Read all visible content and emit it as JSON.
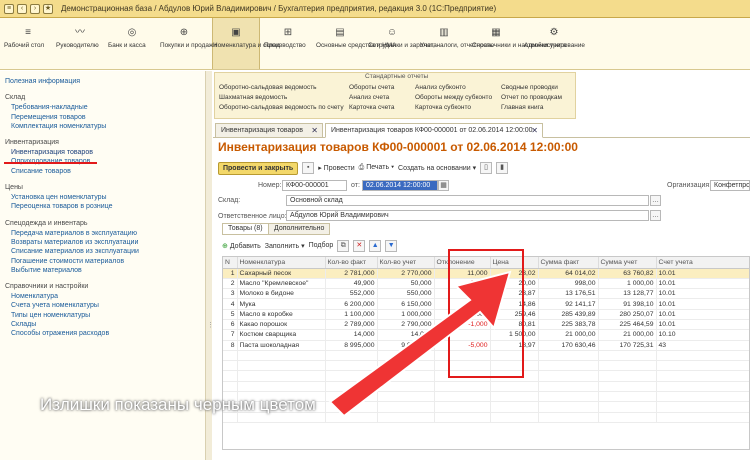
{
  "window": {
    "title": "Демонстрационная база / Абдулов Юрий Владимирович / Бухгалтерия предприятия, редакция 3.0 (1С:Предприятие)"
  },
  "sections": [
    {
      "label": "Рабочий стол",
      "icon": "home-icon"
    },
    {
      "label": "Руководителю",
      "icon": "chart-icon"
    },
    {
      "label": "Банк и касса",
      "icon": "coin-icon"
    },
    {
      "label": "Покупки и продажи",
      "icon": "cart-icon"
    },
    {
      "label": "Номенклатура и склад",
      "icon": "box-icon"
    },
    {
      "label": "Производство",
      "icon": "factory-icon"
    },
    {
      "label": "Основные средства и НМА",
      "icon": "building-icon"
    },
    {
      "label": "Сотрудники и зарплата",
      "icon": "people-icon"
    },
    {
      "label": "Учет, налоги, отчетность",
      "icon": "calculator-icon"
    },
    {
      "label": "Справочники и настройки учета",
      "icon": "book-icon"
    },
    {
      "label": "Администрирование",
      "icon": "gear-icon"
    }
  ],
  "nav": {
    "useful": "Полезная информация",
    "groups": [
      {
        "title": "Склад",
        "items": [
          "Требования-накладные",
          "Перемещения товаров",
          "Комплектация номенклатуры"
        ]
      },
      {
        "title": "Инвентаризация",
        "items": [
          "Инвентаризация товаров",
          "Оприходование товаров",
          "Списание товаров"
        ]
      },
      {
        "title": "Цены",
        "items": [
          "Установка цен номенклатуры",
          "Переоценка товаров в рознице"
        ]
      },
      {
        "title": "Спецодежда и инвентарь",
        "items": [
          "Передача материалов в эксплуатацию",
          "Возвраты материалов из эксплуатации",
          "Списание материалов из эксплуатации",
          "Погашение стоимости материалов",
          "Выбытие материалов"
        ]
      },
      {
        "title": "Справочники и настройки",
        "items": [
          "Номенклатура",
          "Счета учета номенклатуры",
          "Типы цен номенклатуры",
          "Склады",
          "Способы отражения расходов"
        ]
      }
    ]
  },
  "reports": {
    "title": "Стандартные отчеты",
    "items": [
      "Оборотно-сальдовая ведомость",
      "Обороты счета",
      "Анализ субконто",
      "Сводные проводки",
      "Шахматная ведомость",
      "Анализ счета",
      "Обороты между субконто",
      "Отчет по проводкам",
      "Оборотно-сальдовая ведомость по счету",
      "Карточка счета",
      "Карточка субконто",
      "Главная книга"
    ]
  },
  "tabs": [
    "Инвентаризация товаров",
    "Инвентаризация товаров КФ00-000001 от 02.06.2014 12:00:00"
  ],
  "document": {
    "title": "Инвентаризация товаров КФ00-000001 от 02.06.2014 12:00:00",
    "buttons": {
      "post_close": "Провести и закрыть",
      "post": "Провести",
      "print": "Печать",
      "create_based": "Создать на основании"
    },
    "fields": {
      "number_label": "Номер:",
      "number": "КФ00-000001",
      "date_label": "от:",
      "date": "02.06.2014 12:00:00",
      "org_label": "Организация:",
      "org": "Конфетпром",
      "warehouse_label": "Склад:",
      "warehouse": "Основной склад",
      "responsible_label": "Ответственное лицо:",
      "responsible": "Абдулов Юрий Владимирович"
    },
    "inner_tabs": [
      "Товары (8)",
      "Дополнительно"
    ],
    "table_buttons": {
      "add": "Добавить",
      "fill": "Заполнить",
      "pick": "Подбор"
    }
  },
  "table": {
    "columns": [
      "N",
      "Номенклатура",
      "Кол-во факт",
      "Кол-во учет",
      "Отклонение",
      "Цена",
      "Сумма факт",
      "Сумма учет",
      "Счет учета"
    ],
    "rows": [
      [
        "1",
        "Сахарный песок",
        "2 781,000",
        "2 770,000",
        "11,000",
        "23,02",
        "64 014,02",
        "63 760,82",
        "10.01"
      ],
      [
        "2",
        "Масло \"Кремлевское\"",
        "49,900",
        "50,000",
        "-0,100",
        "20,00",
        "998,00",
        "1 000,00",
        "10.01"
      ],
      [
        "3",
        "Молоко в бидоне",
        "552,000",
        "550,000",
        "2,000",
        "23,87",
        "13 176,51",
        "13 128,77",
        "10.01"
      ],
      [
        "4",
        "Мука",
        "6 200,000",
        "6 150,000",
        "50,000",
        "14,86",
        "92 141,17",
        "91 398,10",
        "10.01"
      ],
      [
        "5",
        "Масло в коробке",
        "1 100,000",
        "1 000,000",
        "100,000",
        "259,46",
        "285 439,89",
        "280 250,07",
        "10.01"
      ],
      [
        "6",
        "Какао порошок",
        "2 789,000",
        "2 790,000",
        "-1,000",
        "80,81",
        "225 383,78",
        "225 464,59",
        "10.01"
      ],
      [
        "7",
        "Костюм сварщика",
        "14,000",
        "14,000",
        "",
        "1 500,00",
        "21 000,00",
        "21 000,00",
        "10.10"
      ],
      [
        "8",
        "Паста шоколадная",
        "8 995,000",
        "9 000,000",
        "-5,000",
        "18,97",
        "170 630,46",
        "170 725,31",
        "43"
      ]
    ]
  },
  "caption": "Излишки показаны черным цветом",
  "colors": {
    "highlight": "#e21a1a",
    "title": "#c85a00",
    "accent_panel": "#f4dc8c"
  }
}
